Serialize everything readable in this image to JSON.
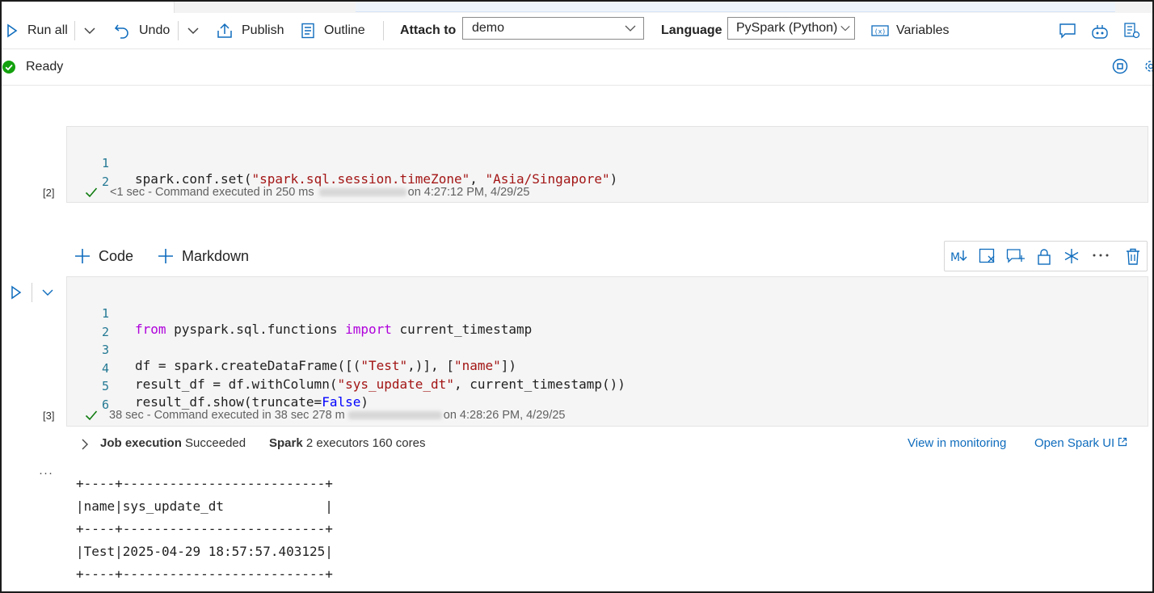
{
  "toolbar": {
    "run_all": "Run all",
    "undo": "Undo",
    "publish": "Publish",
    "outline": "Outline",
    "attach_label": "Attach to",
    "attach_value": "demo",
    "language_label": "Language",
    "language_value": "PySpark (Python)",
    "variables": "Variables",
    "icons": [
      "run-icon",
      "chevron-down-icon",
      "undo-icon",
      "publish-icon",
      "outline-icon",
      "variables-icon",
      "comment-icon",
      "copilot-icon",
      "settings-list-icon"
    ]
  },
  "status": {
    "text": "Ready",
    "color": "#13a10e"
  },
  "cells": [
    {
      "exec_count": "[2]",
      "lines": [
        {
          "n": "1",
          "code": "spark.conf.set(\"spark.sql.session.timeZone\", \"Asia/Singapore\")"
        },
        {
          "n": "2",
          "code": ""
        }
      ],
      "duration": "<1 sec",
      "exec_text_a": "- Command executed in 250 ms",
      "exec_text_b": "on 4:27:12 PM, 4/29/25"
    },
    {
      "exec_count": "[3]",
      "lines": [
        {
          "n": "1",
          "code": "from pyspark.sql.functions import current_timestamp"
        },
        {
          "n": "2",
          "code": ""
        },
        {
          "n": "3",
          "code": "df = spark.createDataFrame([(\"Test\",)], [\"name\"])"
        },
        {
          "n": "4",
          "code": "result_df = df.withColumn(\"sys_update_dt\", current_timestamp())"
        },
        {
          "n": "5",
          "code": "result_df.show(truncate=False)"
        },
        {
          "n": "6",
          "code": ""
        }
      ],
      "duration": "38 sec",
      "exec_text_a": "- Command executed in 38 sec 278 m",
      "exec_text_b": "on 4:28:26 PM, 4/29/25"
    }
  ],
  "add_cell": {
    "code": "Code",
    "markdown": "Markdown"
  },
  "job": {
    "label": "Job execution",
    "status": "Succeeded",
    "spark_label": "Spark",
    "spark_value": "2 executors 160 cores",
    "monitor_link": "View in monitoring",
    "spark_ui_link": "Open Spark UI"
  },
  "output": {
    "more": "···",
    "lines": [
      "+----+--------------------------+",
      "|name|sys_update_dt             |",
      "+----+--------------------------+",
      "|Test|2025-04-29 18:57:57.403125|",
      "+----+--------------------------+"
    ]
  },
  "colors": {
    "accent": "#0f6cbd",
    "success": "#107c10"
  }
}
